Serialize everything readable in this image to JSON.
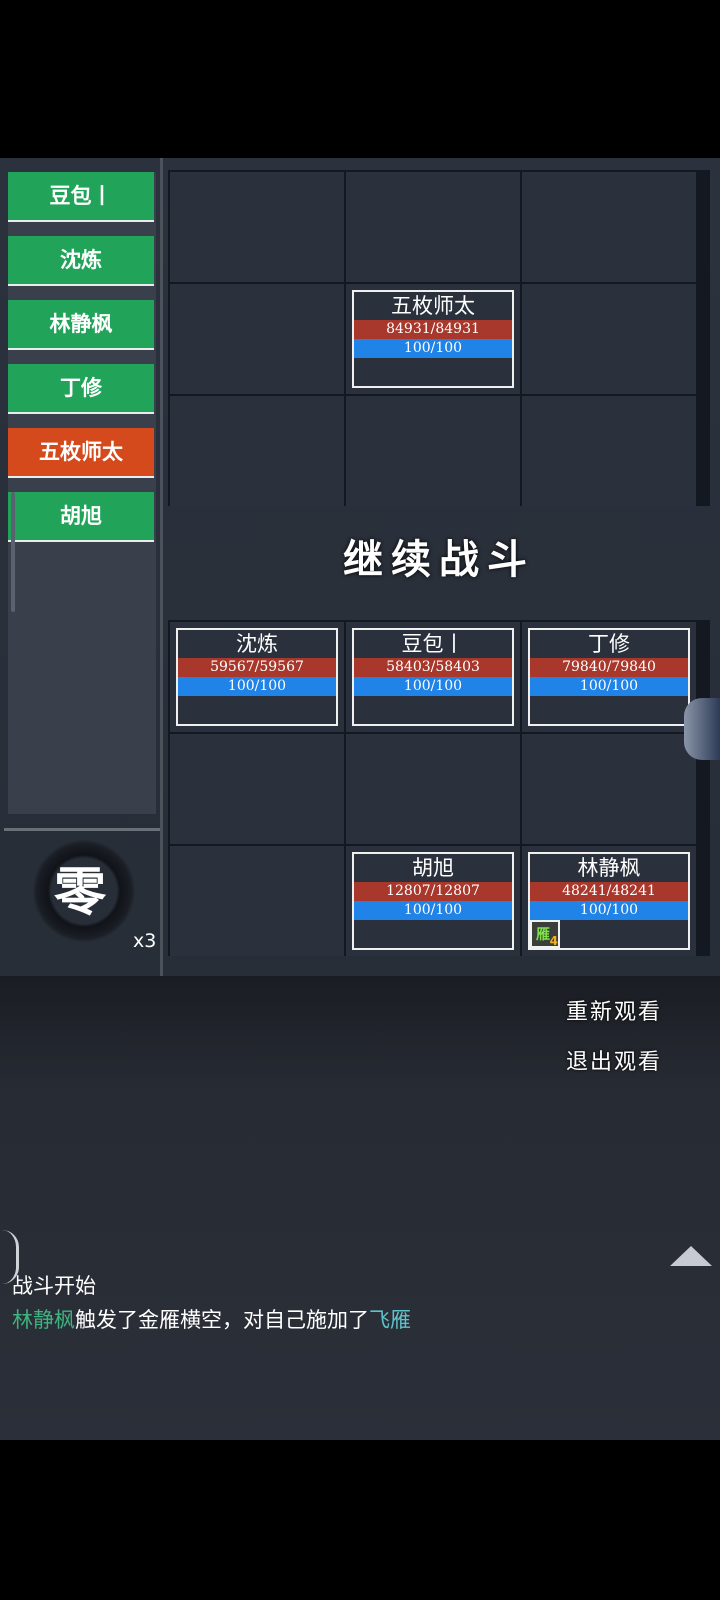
{
  "roster": {
    "items": [
      {
        "label": "豆包丨",
        "state": "green"
      },
      {
        "label": "沈炼",
        "state": "green"
      },
      {
        "label": "林静枫",
        "state": "green"
      },
      {
        "label": "丁修",
        "state": "green"
      },
      {
        "label": "五枚师太",
        "state": "orange"
      },
      {
        "label": "胡旭",
        "state": "green"
      }
    ]
  },
  "speed": {
    "char": "零",
    "multiplier": "x3"
  },
  "battle": {
    "continue_label": "继续战斗",
    "enemy_units": [
      {
        "name": "五枚师太",
        "hp": "84931/84931",
        "mp": "100/100"
      }
    ],
    "ally_units": [
      {
        "name": "沈炼",
        "hp": "59567/59567",
        "mp": "100/100"
      },
      {
        "name": "豆包丨",
        "hp": "58403/58403",
        "mp": "100/100"
      },
      {
        "name": "丁修",
        "hp": "79840/79840",
        "mp": "100/100"
      },
      {
        "name": "胡旭",
        "hp": "12807/12807",
        "mp": "100/100"
      },
      {
        "name": "林静枫",
        "hp": "48241/48241",
        "mp": "100/100",
        "buff": {
          "char": "雁",
          "count": "4"
        }
      }
    ]
  },
  "actions": {
    "replay": "重新观看",
    "exit": "退出观看"
  },
  "log": {
    "line1": "战斗开始",
    "line2": {
      "actor": "林静枫",
      "text": "触发了金雁横空，对自己施加了",
      "effect": "飞雁"
    }
  },
  "colors": {
    "green": "#22a35a",
    "orange": "#d44a1d",
    "hp": "#a8382c",
    "mp": "#1f83e8"
  }
}
